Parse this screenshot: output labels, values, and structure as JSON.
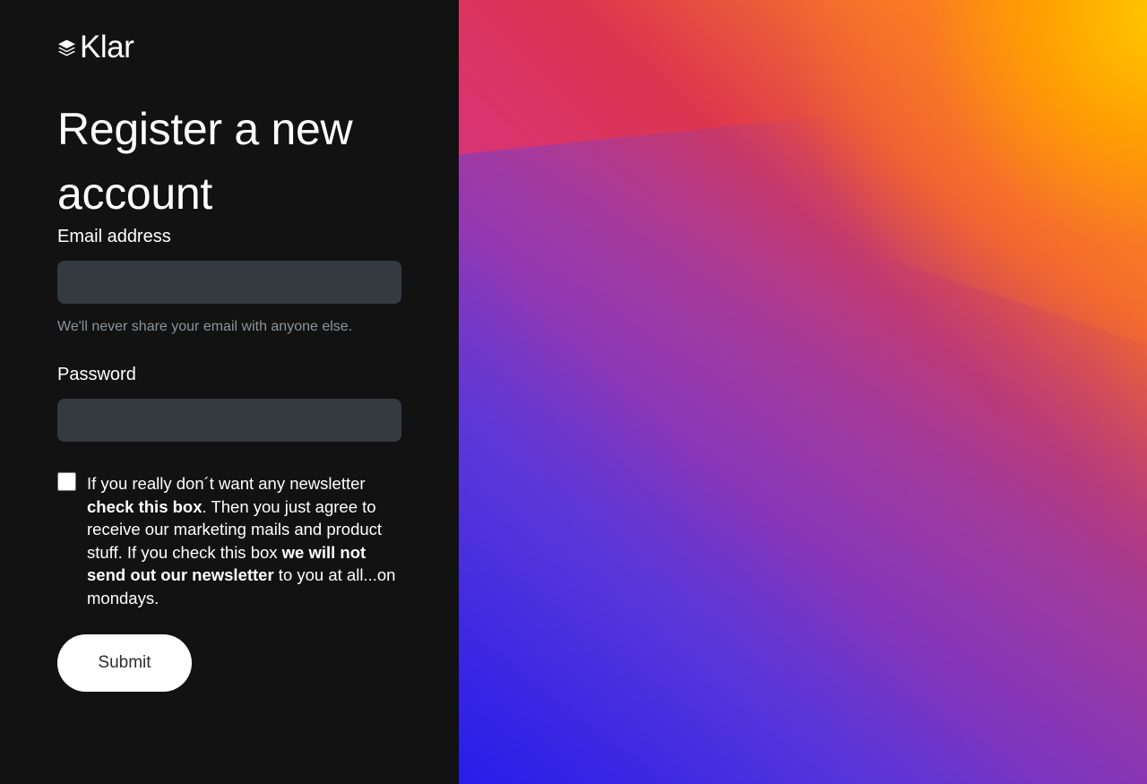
{
  "brand": {
    "name": "Klar",
    "icon": "stacked-layers-icon"
  },
  "page": {
    "title": "Register a new account"
  },
  "form": {
    "email": {
      "label": "Email address",
      "value": "",
      "placeholder": "",
      "help_text": "We'll never share your email with anyone else."
    },
    "password": {
      "label": "Password",
      "value": "",
      "placeholder": ""
    },
    "newsletter_checkbox": {
      "checked": false,
      "text_prefix": "If you really don´t want any newsletter ",
      "text_bold_1": "check this box",
      "text_middle": ". Then you just agree to receive our marketing mails and product stuff. If you check this box ",
      "text_bold_2": "we will not send out our newsletter",
      "text_suffix": " to you at all...on mondays."
    },
    "submit_label": "Submit"
  },
  "colors": {
    "left_background": "#121212",
    "input_background": "#343a40",
    "primary_text": "#ffffff",
    "help_text": "#8d949b",
    "button_background": "#ffffff"
  }
}
